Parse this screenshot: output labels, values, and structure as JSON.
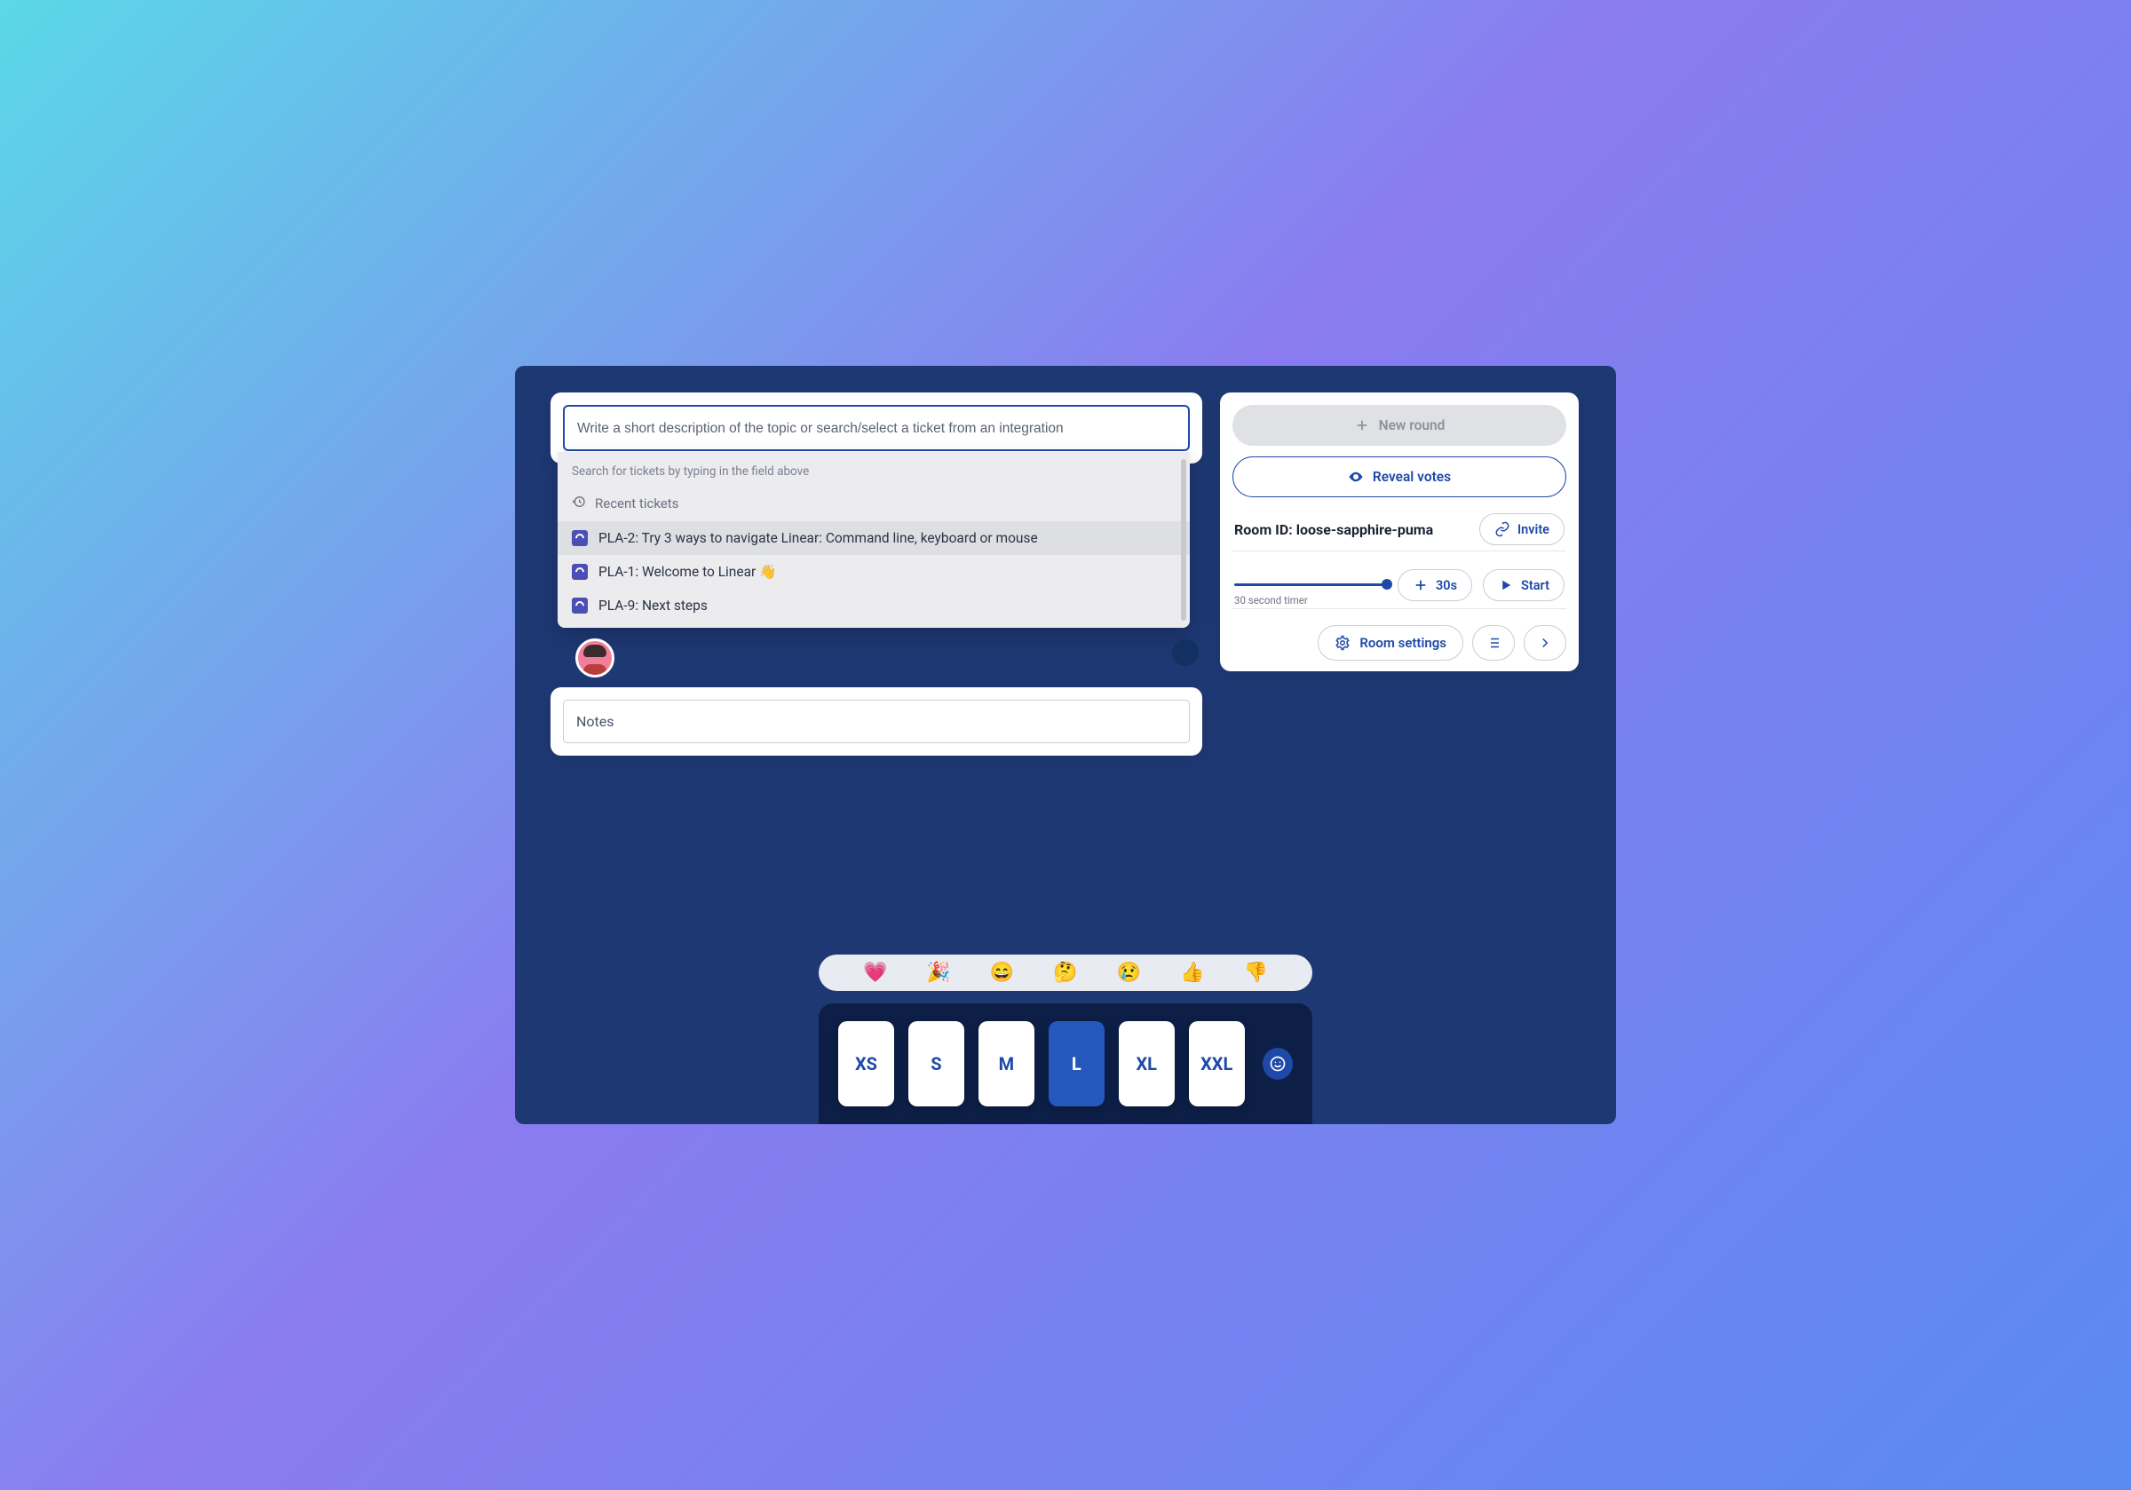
{
  "topic": {
    "placeholder": "Write a short description of the topic or search/select a ticket from an integration",
    "hint": "Search for tickets by typing in the field above",
    "recent_label": "Recent tickets",
    "tickets": [
      "PLA-2: Try 3 ways to navigate Linear: Command line, keyboard or mouse",
      "PLA-1: Welcome to Linear 👋",
      "PLA-9: Next steps"
    ]
  },
  "notes": {
    "placeholder": "Notes"
  },
  "sidebar": {
    "new_round": "New round",
    "reveal": "Reveal votes",
    "room_id_label": "Room ID:",
    "room_id": "loose-sapphire-puma",
    "invite": "Invite",
    "timer_label": "30 second timer",
    "add_time": "30s",
    "start": "Start",
    "settings": "Room settings"
  },
  "emojis": [
    "💗",
    "🎉",
    "😄",
    "🤔",
    "😢",
    "👍",
    "👎"
  ],
  "cards": [
    "XS",
    "S",
    "M",
    "L",
    "XL",
    "XXL"
  ],
  "selected_card": "L"
}
